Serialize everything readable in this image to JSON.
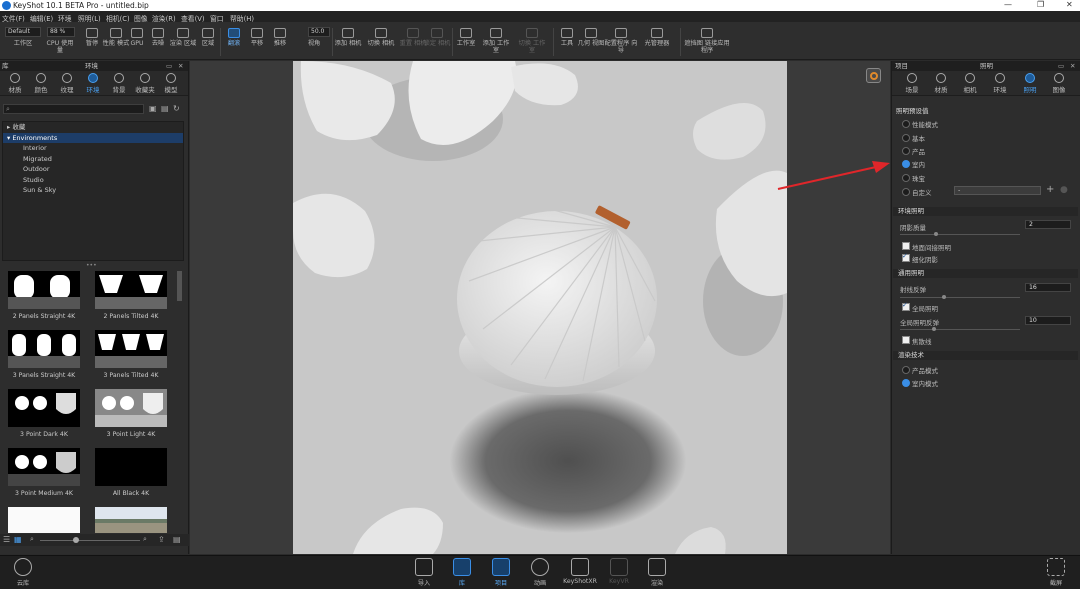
{
  "app": {
    "title": "KeyShot 10.1 BETA Pro  - untitled.bip"
  },
  "window_controls": {
    "minimize": "—",
    "maximize": "❐",
    "close": "✕"
  },
  "menu": [
    "文件(F)",
    "编辑(E)",
    "环境",
    "照明(L)",
    "相机(C)",
    "图像",
    "渲染(R)",
    "查看(V)",
    "窗口",
    "帮助(H)"
  ],
  "toolbar": {
    "preset": "Default",
    "zoom": "88 %",
    "fov": "50.0",
    "items": [
      {
        "label": "工作区",
        "state": "normal"
      },
      {
        "label": "CPU 使用量",
        "state": "normal"
      },
      {
        "label": "暂停",
        "state": "normal"
      },
      {
        "label": "性能 模式",
        "state": "normal"
      },
      {
        "label": "GPU",
        "state": "normal"
      },
      {
        "label": "去噪",
        "state": "normal"
      },
      {
        "label": "渲染 区域",
        "state": "normal"
      },
      {
        "label": "区域",
        "state": "normal"
      },
      {
        "label": "翻滚",
        "state": "active"
      },
      {
        "label": "平移",
        "state": "normal"
      },
      {
        "label": "推移",
        "state": "normal"
      },
      {
        "label": "视角",
        "state": "normal"
      },
      {
        "label": "添加 相机",
        "state": "normal"
      },
      {
        "label": "切换 相机",
        "state": "normal"
      },
      {
        "label": "重置 相机",
        "state": "dim"
      },
      {
        "label": "锁定 相机",
        "state": "dim"
      },
      {
        "label": "工作室",
        "state": "normal"
      },
      {
        "label": "添加 工作室",
        "state": "normal"
      },
      {
        "label": "切换 工作室",
        "state": "dim"
      },
      {
        "label": "工具",
        "state": "normal"
      },
      {
        "label": "几何 视图",
        "state": "normal"
      },
      {
        "label": "配置程序 向导",
        "state": "normal"
      },
      {
        "label": "光管理器",
        "state": "normal"
      },
      {
        "label": "遮挡图 链接应用程序",
        "state": "normal"
      }
    ]
  },
  "library": {
    "title": "库",
    "header": "环境",
    "tabs": [
      "材质",
      "颜色",
      "纹理",
      "环境",
      "背景",
      "收藏夹",
      "模型"
    ],
    "active_tab": "环境",
    "search_placeholder": "",
    "tree": [
      {
        "label": "▸ 收藏",
        "selected": false,
        "indent": 0
      },
      {
        "label": "▾ Environments",
        "selected": true,
        "indent": 0
      },
      {
        "label": "Interior",
        "selected": false,
        "indent": 1
      },
      {
        "label": "Migrated",
        "selected": false,
        "indent": 1
      },
      {
        "label": "Outdoor",
        "selected": false,
        "indent": 1
      },
      {
        "label": "Studio",
        "selected": false,
        "indent": 1
      },
      {
        "label": "Sun & Sky",
        "selected": false,
        "indent": 1
      }
    ],
    "thumbnails": [
      "2 Panels Straight 4K",
      "2 Panels Tilted 4K",
      "3 Panels Straight 4K",
      "3 Panels Tilted 4K",
      "3 Point Dark 4K",
      "3 Point Light 4K",
      "3 Point Medium 4K",
      "All Black 4K"
    ]
  },
  "project": {
    "title": "项目",
    "header": "照明",
    "tabs": [
      "场景",
      "材质",
      "相机",
      "环境",
      "照明",
      "图像"
    ],
    "active_tab": "照明",
    "presets_title": "照明预设值",
    "presets": [
      {
        "label": "性能模式",
        "selected": false
      },
      {
        "label": "基本",
        "selected": false
      },
      {
        "label": "产品",
        "selected": false
      },
      {
        "label": "室内",
        "selected": true
      },
      {
        "label": "珠宝",
        "selected": false
      },
      {
        "label": "自定义",
        "selected": false
      }
    ],
    "custom_value": "-",
    "env_lighting": {
      "title": "环境照明",
      "shadow_quality_label": "阴影质量",
      "shadow_quality": "2",
      "shadow_quality_level": 0.3,
      "ground_indirect": {
        "label": "地面间接照明",
        "checked": false
      },
      "fine_shadows": {
        "label": "细化阴影",
        "checked": true
      }
    },
    "general_lighting": {
      "title": "通用照明",
      "ray_bounces_label": "射线反弹",
      "ray_bounces": "16",
      "ray_bounces_level": 0.37,
      "global_illum": {
        "label": "全局照明",
        "checked": true
      },
      "gi_bounces_label": "全局照明反弹",
      "gi_bounces": "10",
      "gi_bounces_level": 0.28,
      "caustics": {
        "label": "焦散线",
        "checked": false
      }
    },
    "render_tech": {
      "title": "渲染技术",
      "options": [
        {
          "label": "产品模式",
          "selected": false
        },
        {
          "label": "室内模式",
          "selected": true
        }
      ]
    }
  },
  "bottom": {
    "cloud": "云库",
    "buttons": [
      {
        "label": "导入",
        "state": "normal"
      },
      {
        "label": "库",
        "state": "active"
      },
      {
        "label": "项目",
        "state": "active"
      },
      {
        "label": "动画",
        "state": "normal"
      },
      {
        "label": "KeyShotXR",
        "state": "normal"
      },
      {
        "label": "KeyVR",
        "state": "dim"
      },
      {
        "label": "渲染",
        "state": "normal"
      }
    ],
    "screenshot": "截屏"
  }
}
